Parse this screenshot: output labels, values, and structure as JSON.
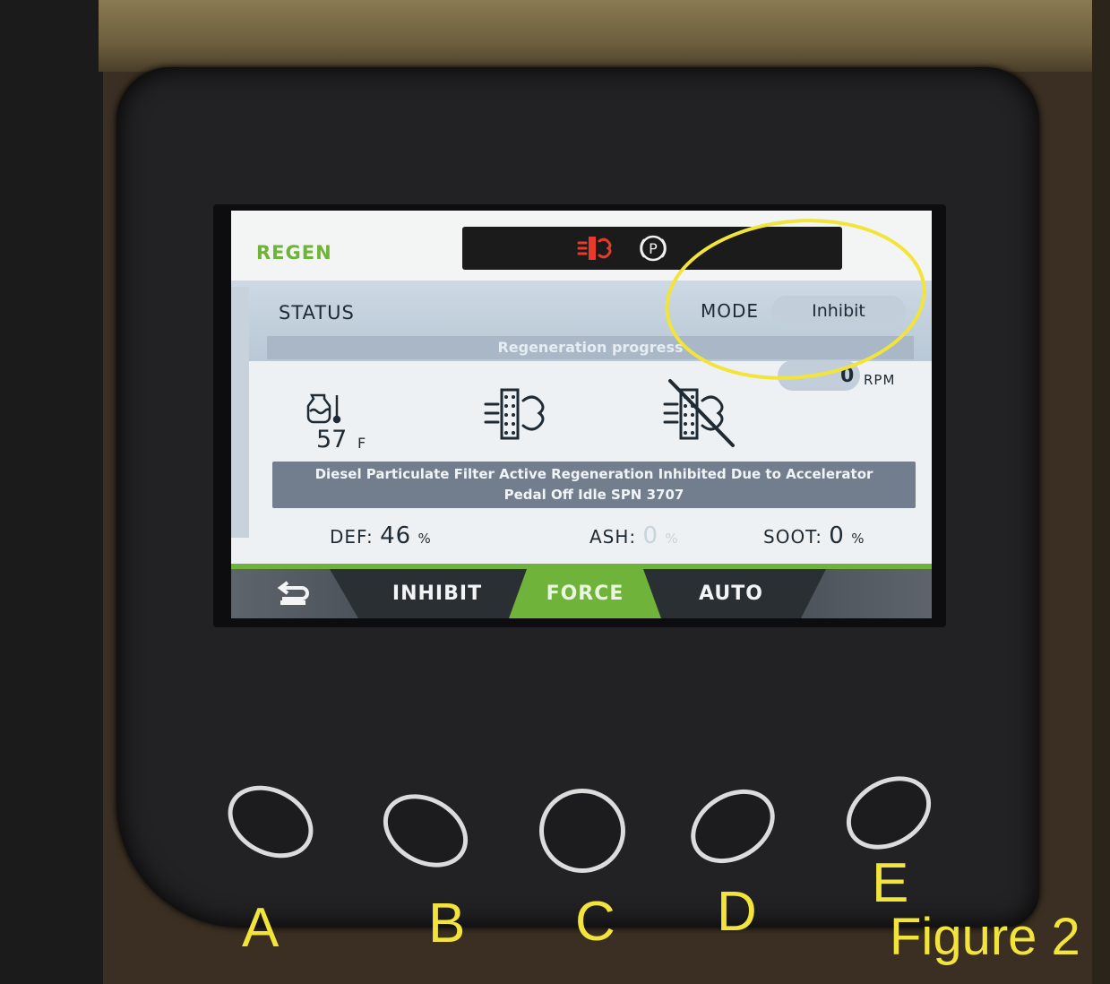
{
  "screen": {
    "title": "REGEN",
    "indicators": [
      "dpf-regen-icon",
      "parking-brake-icon"
    ],
    "park_symbol": "P",
    "status_label": "STATUS",
    "mode": {
      "label": "MODE",
      "value": "Inhibit"
    },
    "progress_label": "Regeneration progress",
    "rpm": {
      "value": "0",
      "unit": "RPM"
    },
    "temperature": {
      "value": "57",
      "unit": "F"
    },
    "message": {
      "line1": "Diesel Particulate Filter Active Regeneration Inhibited Due to Accelerator",
      "line2": "Pedal Off Idle SPN 3707"
    },
    "stats": {
      "def": {
        "label": "DEF:",
        "value": "46",
        "unit": "%"
      },
      "ash": {
        "label": "ASH:",
        "value": "0",
        "unit": "%"
      },
      "soot": {
        "label": "SOOT:",
        "value": "0",
        "unit": "%"
      }
    },
    "softkeys": {
      "back_icon": "back-arrow-icon",
      "inhibit": "INHIBIT",
      "force": "FORCE",
      "auto": "AUTO"
    }
  },
  "hardware_buttons": [
    "A",
    "B",
    "C",
    "D",
    "E"
  ],
  "caption": "Figure 2",
  "colors": {
    "accent_green": "#6fb33a",
    "warning_red": "#e83a2a",
    "highlight_yellow": "#f2e43a"
  }
}
